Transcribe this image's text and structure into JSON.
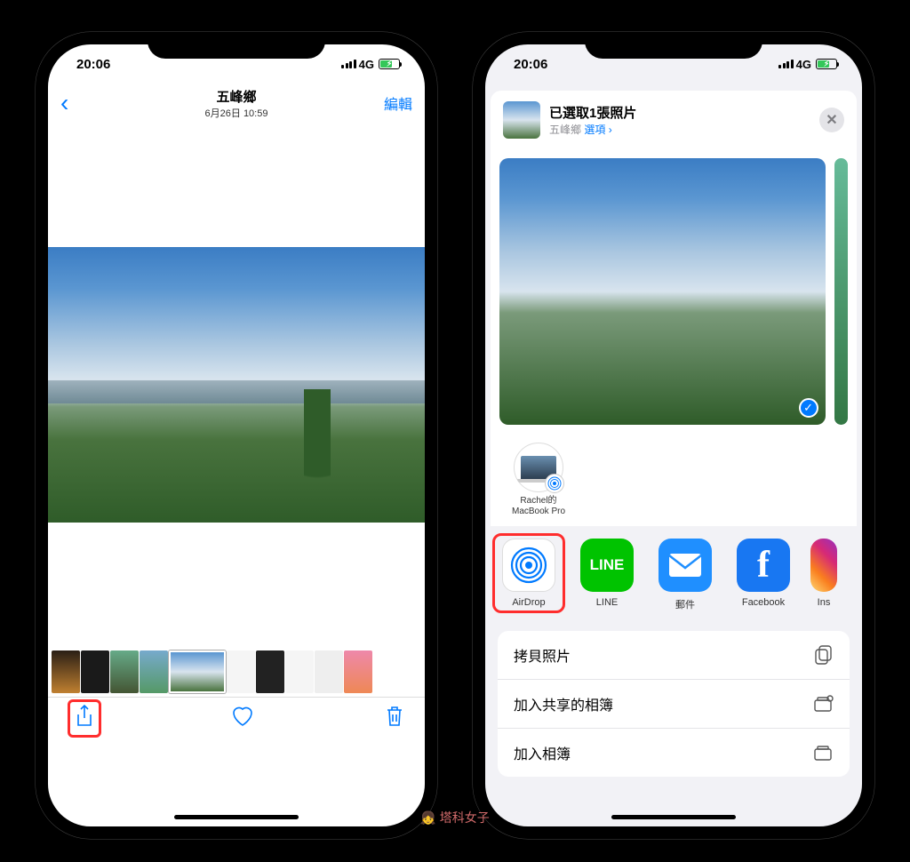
{
  "status": {
    "time": "20:06",
    "carrier": "4G"
  },
  "phone1": {
    "nav": {
      "location": "五峰鄉",
      "timestamp": "6月26日 10:59",
      "edit": "編輯"
    }
  },
  "phone2": {
    "header": {
      "title": "已選取1張照片",
      "subtitle_location": "五峰鄉",
      "subtitle_options": "選項",
      "chevron": "›"
    },
    "airdrop_target": {
      "line1": "Rachel的",
      "line2": "MacBook Pro"
    },
    "apps": {
      "airdrop": "AirDrop",
      "line": "LINE",
      "mail": "郵件",
      "facebook": "Facebook",
      "instagram_partial": "Ins"
    },
    "actions": {
      "copy": "拷貝照片",
      "add_shared": "加入共享的相簿",
      "add_album": "加入相簿"
    }
  },
  "watermark": "塔科女子"
}
